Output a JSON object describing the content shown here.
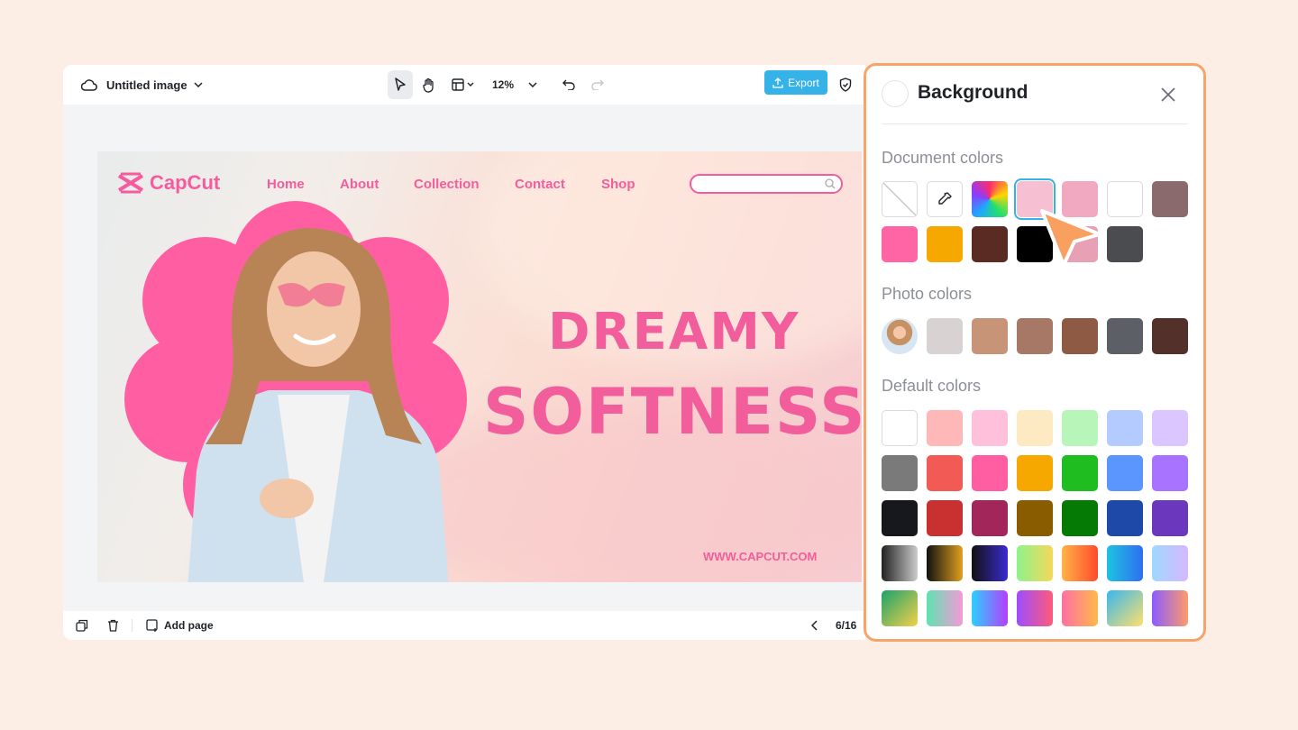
{
  "topbar": {
    "title": "Untitled image",
    "zoom": "12%",
    "export_label": "Export"
  },
  "canvas": {
    "brand": "CapCut",
    "nav": [
      "Home",
      "About",
      "Collection",
      "Contact",
      "Shop"
    ],
    "headline_1": "DREAMY",
    "headline_2": "SOFTNESS",
    "url": "WWW.CAPCUT.COM"
  },
  "bottombar": {
    "add_page": "Add page",
    "page_counter": "6/16"
  },
  "panel": {
    "title": "Background",
    "document_colors_label": "Document colors",
    "photo_colors_label": "Photo colors",
    "default_colors_label": "Default colors",
    "document_colors": [
      "none",
      "eyedropper",
      "rainbow",
      "#f6c0d2",
      "#f0a9c0",
      "#ffffff",
      "#8b6a6e",
      "#ff64a5",
      "#f7a800",
      "#5a2b22",
      "#000000",
      "#e8a0b4",
      "#4a4c50"
    ],
    "photo_colors": [
      "photo",
      "#d9d2d2",
      "#c89478",
      "#a87866",
      "#8e5a44",
      "#5c5f66",
      "#54302a"
    ],
    "default_colors": [
      [
        "#ffffff",
        "#ffb8b8",
        "#ffc0db",
        "#fde9c2",
        "#b8f5b8",
        "#b3cbff",
        "#dcc6ff"
      ],
      [
        "#7a7a7a",
        "#f25a55",
        "#ff5fa2",
        "#f7a800",
        "#1fbd1f",
        "#5b96ff",
        "#a874ff"
      ],
      [
        "#16181d",
        "#c8312f",
        "#a3265a",
        "#8a5c00",
        "#057a05",
        "#1f49a8",
        "#6b38bd"
      ],
      [
        "linear-gradient(90deg,#222,#ccc)",
        "linear-gradient(90deg,#111,#e0a020)",
        "linear-gradient(90deg,#111,#3a2bd0)",
        "linear-gradient(90deg,#8ff28b,#f5d85a)",
        "linear-gradient(90deg,#ffb347,#ff4a2a)",
        "linear-gradient(90deg,#1ec3e0,#2e6ff0)",
        "linear-gradient(90deg,#9fd8ff,#d6b8ff)"
      ],
      [
        "linear-gradient(135deg,#1aa36b,#f5d04a)",
        "linear-gradient(90deg,#5ee2b0,#f59ad8)",
        "linear-gradient(90deg,#2ad1ff,#b63cff)",
        "linear-gradient(90deg,#9d4dff,#ff5a7a)",
        "linear-gradient(90deg,#ff6fa5,#ffb84a)",
        "linear-gradient(135deg,#37b7f0,#ffe06a)",
        "linear-gradient(90deg,#8a5cff,#ff9a6a)"
      ]
    ]
  }
}
